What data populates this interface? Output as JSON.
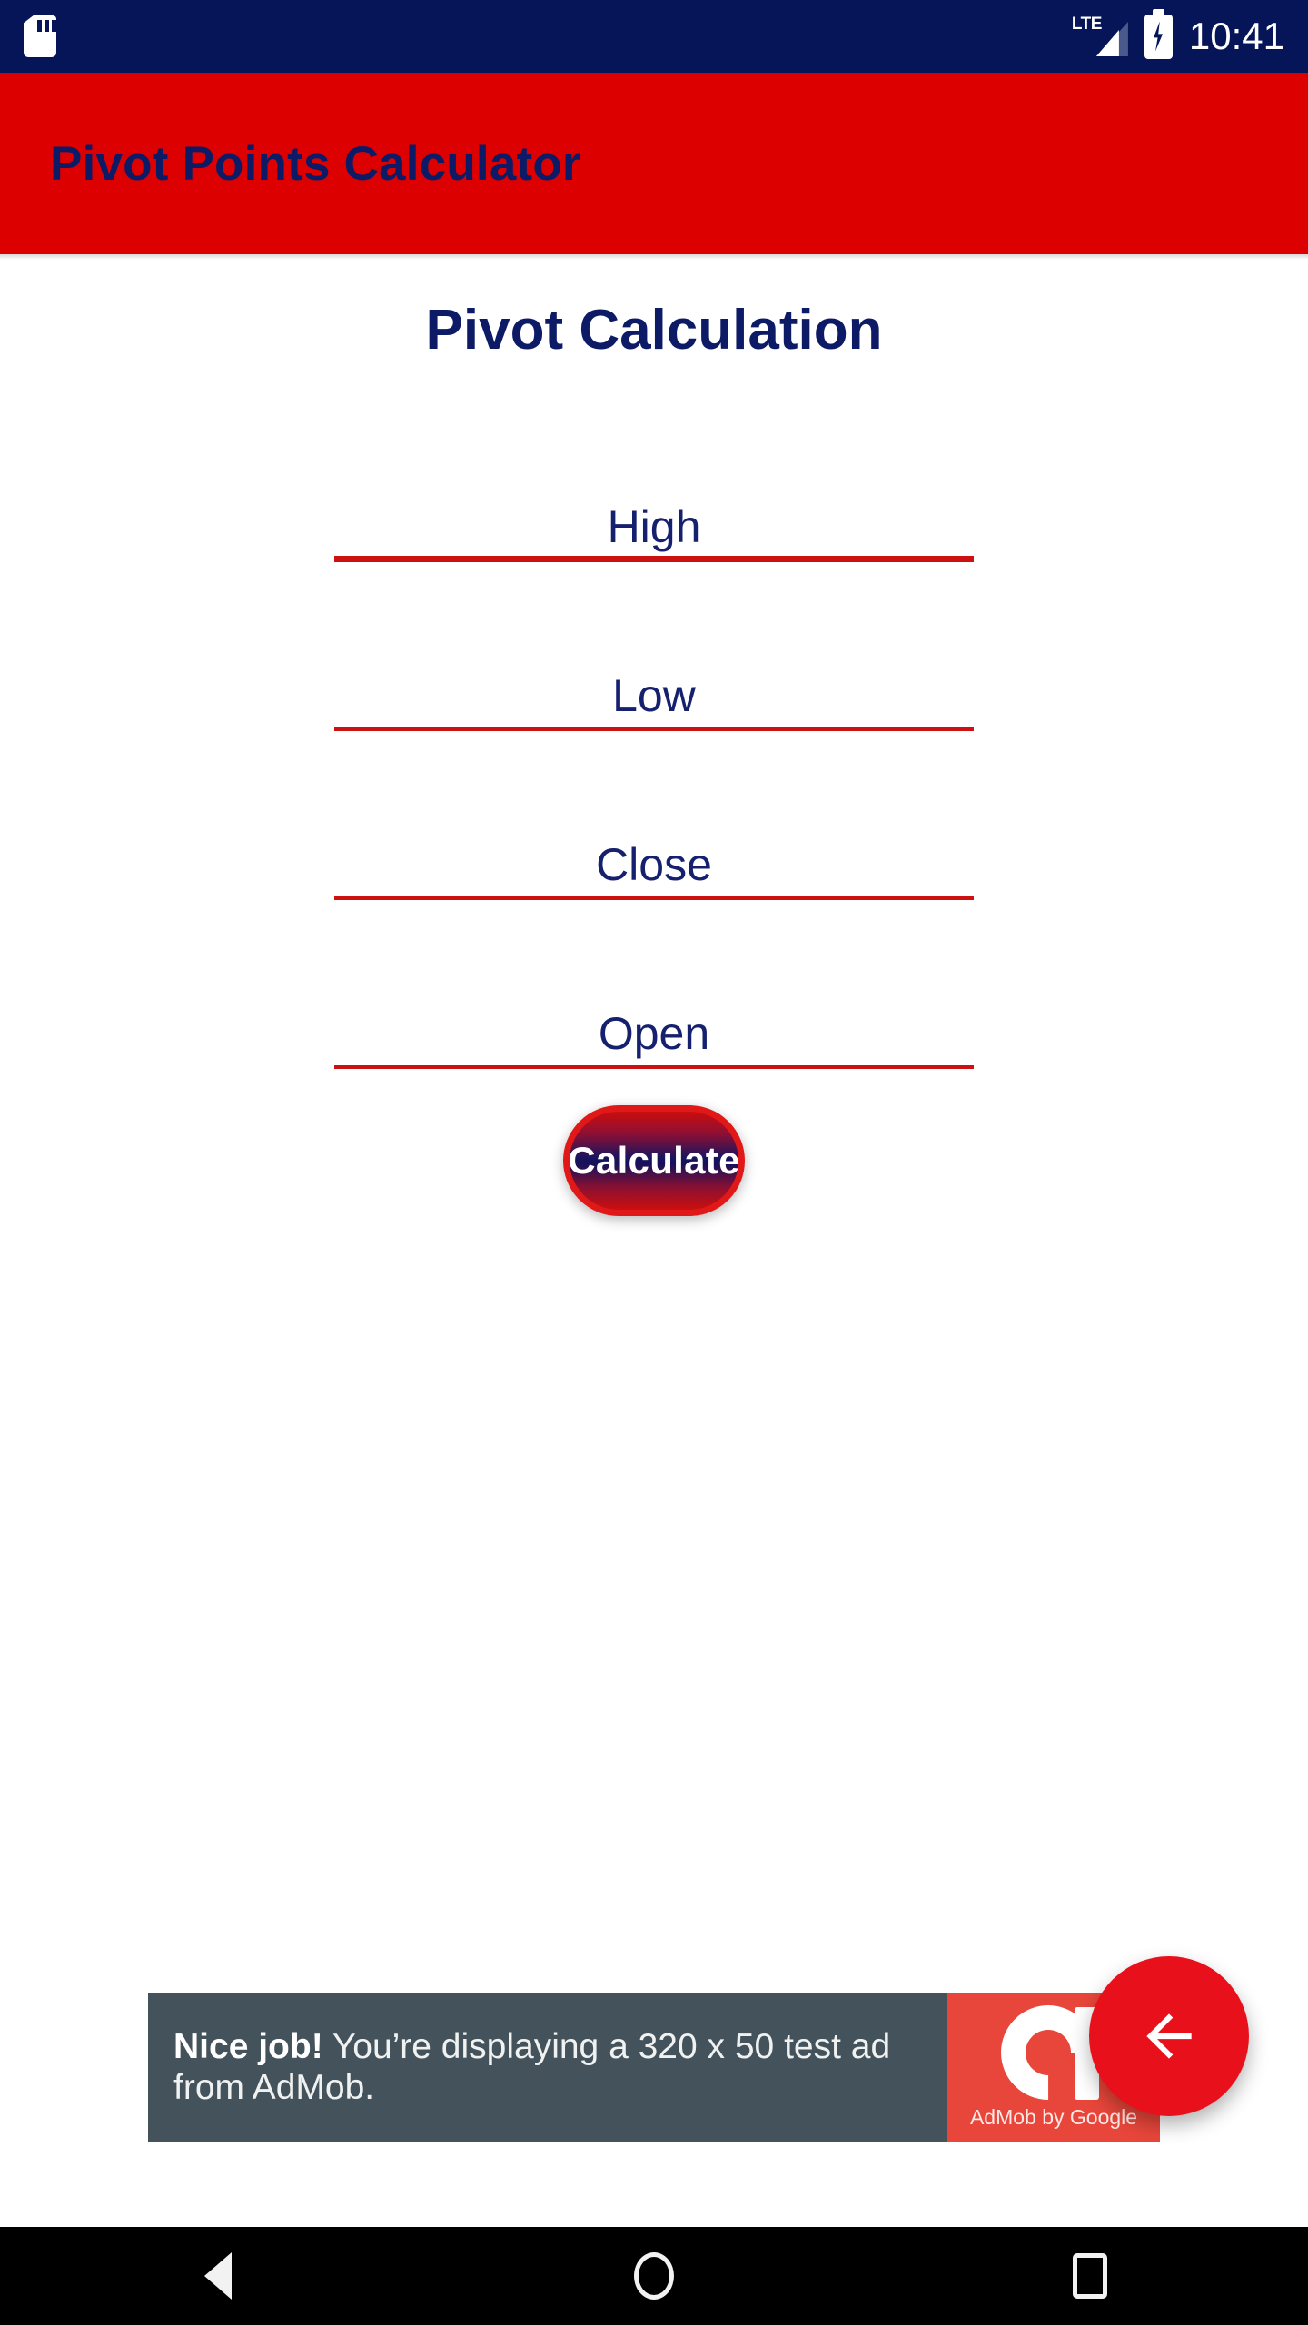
{
  "status_bar": {
    "sd_card_icon": "sd-card-icon",
    "network_label": "LTE",
    "signal_icon": "signal-bars-icon",
    "battery_icon": "battery-charging-icon",
    "time": "10:41"
  },
  "app_bar": {
    "title": "Pivot Points Calculator",
    "background_color": "#DD0000",
    "title_color": "#0d1b66"
  },
  "main": {
    "heading": "Pivot Calculation",
    "fields": [
      {
        "name": "high",
        "placeholder": "High",
        "value": ""
      },
      {
        "name": "low",
        "placeholder": "Low",
        "value": ""
      },
      {
        "name": "close",
        "placeholder": "Close",
        "value": ""
      },
      {
        "name": "open",
        "placeholder": "Open",
        "value": ""
      }
    ],
    "calculate_button": {
      "label": "Calculate",
      "border_color": "#E01818",
      "text_color": "#ffffff"
    }
  },
  "ad_banner": {
    "headline": "Nice job!",
    "body": " You’re displaying a 320 x 50 test ad from AdMob.",
    "logo_label": "AdMob by Google",
    "logo_icon": "admob-logo-icon",
    "background_color": "#44535B",
    "logo_panel_color": "#E8463A"
  },
  "fab": {
    "icon": "arrow-left-icon",
    "color": "#E8111B"
  },
  "nav_bar": {
    "back": "back-triangle-icon",
    "home": "home-circle-icon",
    "recents": "recents-square-icon"
  }
}
